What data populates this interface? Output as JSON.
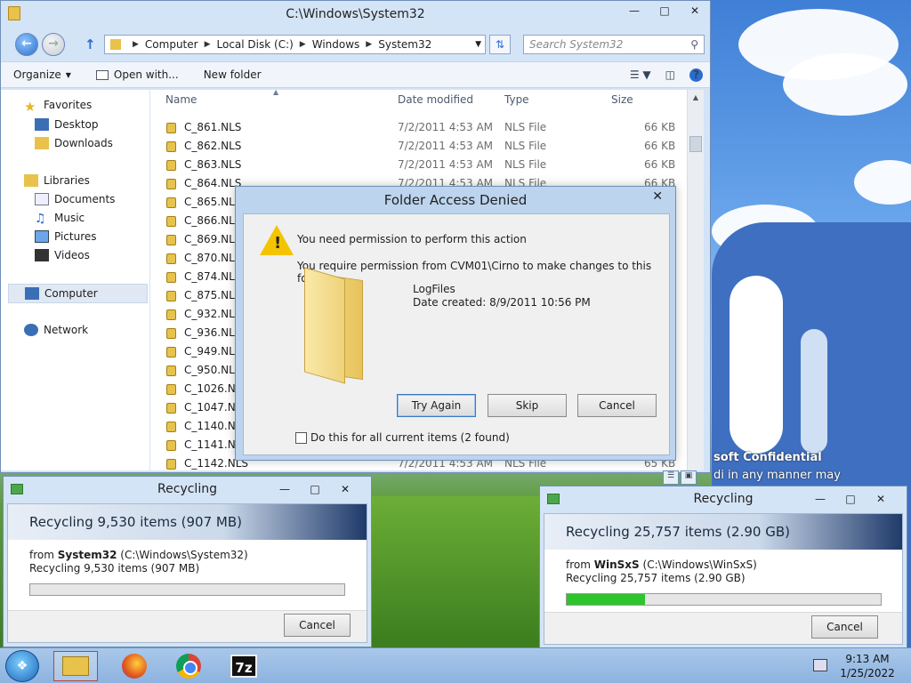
{
  "explorer": {
    "title": "C:\\Windows\\System32",
    "breadcrumb": [
      "Computer",
      "Local Disk (C:)",
      "Windows",
      "System32"
    ],
    "search_placeholder": "Search System32",
    "toolbar": {
      "organize": "Organize",
      "open_with": "Open with...",
      "new_folder": "New folder"
    },
    "nav": {
      "favorites": "Favorites",
      "desktop": "Desktop",
      "downloads": "Downloads",
      "libraries": "Libraries",
      "documents": "Documents",
      "music": "Music",
      "pictures": "Pictures",
      "videos": "Videos",
      "computer": "Computer",
      "network": "Network"
    },
    "columns": {
      "name": "Name",
      "date": "Date modified",
      "type": "Type",
      "size": "Size"
    },
    "files": [
      {
        "name": "C_861.NLS",
        "date": "7/2/2011 4:53 AM",
        "type": "NLS File",
        "size": "66 KB"
      },
      {
        "name": "C_862.NLS",
        "date": "7/2/2011 4:53 AM",
        "type": "NLS File",
        "size": "66 KB"
      },
      {
        "name": "C_863.NLS",
        "date": "7/2/2011 4:53 AM",
        "type": "NLS File",
        "size": "66 KB"
      },
      {
        "name": "C_864.NLS",
        "date": "7/2/2011 4:53 AM",
        "type": "NLS File",
        "size": "66 KB"
      },
      {
        "name": "C_865.NLS",
        "date": "",
        "type": "",
        "size": ""
      },
      {
        "name": "C_866.NLS",
        "date": "",
        "type": "",
        "size": ""
      },
      {
        "name": "C_869.NLS",
        "date": "",
        "type": "",
        "size": ""
      },
      {
        "name": "C_870.NLS",
        "date": "",
        "type": "",
        "size": ""
      },
      {
        "name": "C_874.NLS",
        "date": "",
        "type": "",
        "size": ""
      },
      {
        "name": "C_875.NLS",
        "date": "",
        "type": "",
        "size": ""
      },
      {
        "name": "C_932.NLS",
        "date": "",
        "type": "",
        "size": ""
      },
      {
        "name": "C_936.NLS",
        "date": "",
        "type": "",
        "size": ""
      },
      {
        "name": "C_949.NLS",
        "date": "",
        "type": "",
        "size": ""
      },
      {
        "name": "C_950.NLS",
        "date": "",
        "type": "",
        "size": ""
      },
      {
        "name": "C_1026.NLS",
        "date": "",
        "type": "",
        "size": ""
      },
      {
        "name": "C_1047.NLS",
        "date": "",
        "type": "",
        "size": ""
      },
      {
        "name": "C_1140.NLS",
        "date": "",
        "type": "",
        "size": ""
      },
      {
        "name": "C_1141.NLS",
        "date": "",
        "type": "",
        "size": ""
      },
      {
        "name": "C_1142.NLS",
        "date": "7/2/2011 4:53 AM",
        "type": "NLS File",
        "size": "65 KB"
      }
    ]
  },
  "dialog": {
    "title": "Folder Access Denied",
    "line1": "You need permission to perform this action",
    "line2": "You require permission from CVM01\\Cirno to make changes to this folder",
    "folder_name": "LogFiles",
    "folder_date": "Date created: 8/9/2011 10:56 PM",
    "try_again": "Try Again",
    "skip": "Skip",
    "cancel": "Cancel",
    "checkbox": "Do this for all current items (2 found)"
  },
  "recycle1": {
    "title": "Recycling",
    "header": "Recycling 9,530 items (907 MB)",
    "from_label": "from",
    "from_name": "System32",
    "from_path": "(C:\\Windows\\System32)",
    "status": "Recycling 9,530 items (907 MB)",
    "progress": 0,
    "cancel": "Cancel"
  },
  "recycle2": {
    "title": "Recycling",
    "header": "Recycling 25,757 items (2.90 GB)",
    "from_label": "from",
    "from_name": "WinSxS",
    "from_path": "(C:\\Windows\\WinSxS)",
    "status": "Recycling 25,757 items (2.90 GB)",
    "progress": 0.25,
    "cancel": "Cancel"
  },
  "desktop": {
    "watermark_line1": "soft Confidential",
    "watermark_line2": "di      in any manner may"
  },
  "taskbar": {
    "time": "9:13 AM",
    "date": "1/25/2022",
    "seven_zip": "7z"
  }
}
